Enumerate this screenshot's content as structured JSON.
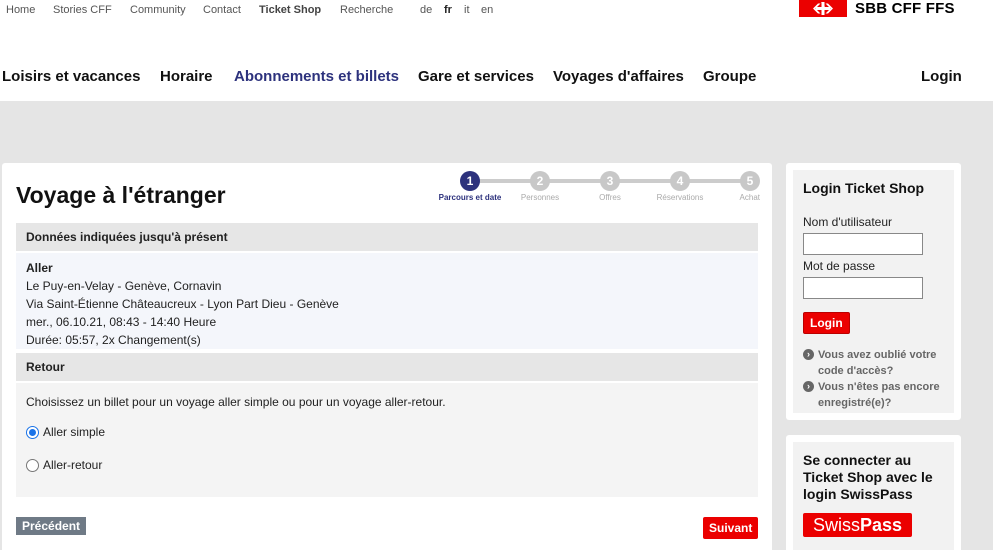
{
  "topbar": {
    "links": [
      "Home",
      "Stories CFF",
      "Community",
      "Contact",
      "Ticket Shop",
      "Recherche"
    ],
    "languages": [
      "de",
      "fr",
      "it",
      "en"
    ],
    "active_language": "fr"
  },
  "brand": {
    "name": "SBB CFF FFS",
    "color": "#eb0000"
  },
  "nav": {
    "items": [
      "Loisirs et vacances",
      "Horaire",
      "Abonnements et billets",
      "Gare et services",
      "Voyages d'affaires",
      "Groupe"
    ],
    "active": "Abonnements et billets",
    "login": "Login"
  },
  "page": {
    "title": "Voyage à l'étranger"
  },
  "steps": [
    {
      "number": "1",
      "label": "Parcours et date",
      "active": true
    },
    {
      "number": "2",
      "label": "Personnes",
      "active": false
    },
    {
      "number": "3",
      "label": "Offres",
      "active": false
    },
    {
      "number": "4",
      "label": "Réservations",
      "active": false
    },
    {
      "number": "5",
      "label": "Achat",
      "active": false
    }
  ],
  "summary": {
    "heading": "Données indiquées jusqu'à présent",
    "outbound": {
      "label": "Aller",
      "route": "Le Puy-en-Velay - Genève, Cornavin",
      "via": "Via Saint-Étienne Châteaucreux - Lyon Part Dieu - Genève",
      "datetime": "mer., 06.10.21, 08:43 - 14:40 Heure",
      "duration": "Durée: 05:57, 2x Changement(s)"
    },
    "return_heading": "Retour",
    "prompt": "Choisissez un billet pour un voyage aller simple ou pour un voyage aller-retour.",
    "options": [
      "Aller simple",
      "Aller-retour"
    ],
    "selected": "Aller simple"
  },
  "buttons": {
    "previous": "Précédent",
    "next": "Suivant"
  },
  "login_box": {
    "title": "Login Ticket Shop",
    "username_label": "Nom d'utilisateur",
    "password_label": "Mot de passe",
    "username_value": "",
    "password_value": "",
    "submit": "Login",
    "links": [
      "Vous avez oublié votre code d'accès?",
      "Vous n'êtes pas encore enregistré(e)?"
    ]
  },
  "swisspass_box": {
    "title": "Se connecter au Ticket Shop avec le login SwissPass",
    "logo_left": "Swiss",
    "logo_right": "Pass"
  }
}
